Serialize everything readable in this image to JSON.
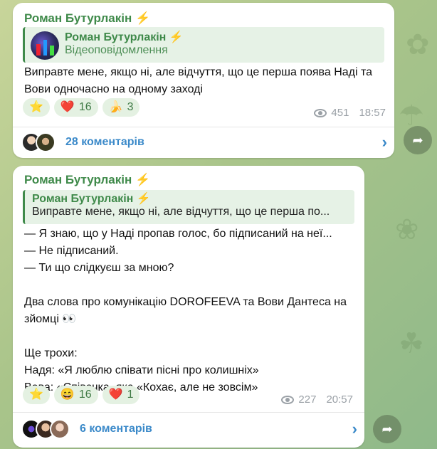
{
  "messages": [
    {
      "author": "Роман Бутурлакін",
      "author_badge": "⚡",
      "reply": {
        "author": "Роман Бутурлакін",
        "badge": "⚡",
        "subtitle": "Відеоповідомлення"
      },
      "text": "Виправте мене, якщо ні, але відчуття, що це перша поява Наді та Вови одночасно на одному заході",
      "reactions": [
        {
          "emoji": "⭐",
          "count": ""
        },
        {
          "emoji": "❤️",
          "count": "16"
        },
        {
          "emoji": "🍌",
          "count": "3"
        }
      ],
      "views": "451",
      "time": "18:57",
      "comments_label": "28 коментарів"
    },
    {
      "author": "Роман Бутурлакін",
      "author_badge": "⚡",
      "reply": {
        "author": "Роман Бутурлакін",
        "badge": "⚡",
        "text": "Виправте мене, якщо ні, але відчуття, що це перша по..."
      },
      "lines": [
        "— Я знаю, що у Наді пропав голос, бо підписаний на неї...",
        "— Не підписаний.",
        "— Ти що слідкуєш за мною?",
        "",
        "Два слова про комунікацію DOROFEEVA та Вови Дантеса на",
        "зйомці 👀",
        "",
        "Ще трохи:",
        "Надя: «Я люблю співати пісні про колишніх»",
        "Вова: «Співачка, яка «Кохає, але не зовсім»"
      ],
      "reactions": [
        {
          "emoji": "⭐",
          "count": ""
        },
        {
          "emoji": "😄",
          "count": "16"
        },
        {
          "emoji": "❤️",
          "count": "1"
        }
      ],
      "views": "227",
      "time": "20:57",
      "comments_label": "6 коментарів"
    }
  ],
  "icons": {
    "share": "share-arrow-icon",
    "chevron": "chevron-right-icon",
    "views": "eye-icon"
  },
  "colors": {
    "accent_green": "#3f8a4a",
    "link_blue": "#3a89c9",
    "reaction_bg": "#e4f1e2"
  }
}
